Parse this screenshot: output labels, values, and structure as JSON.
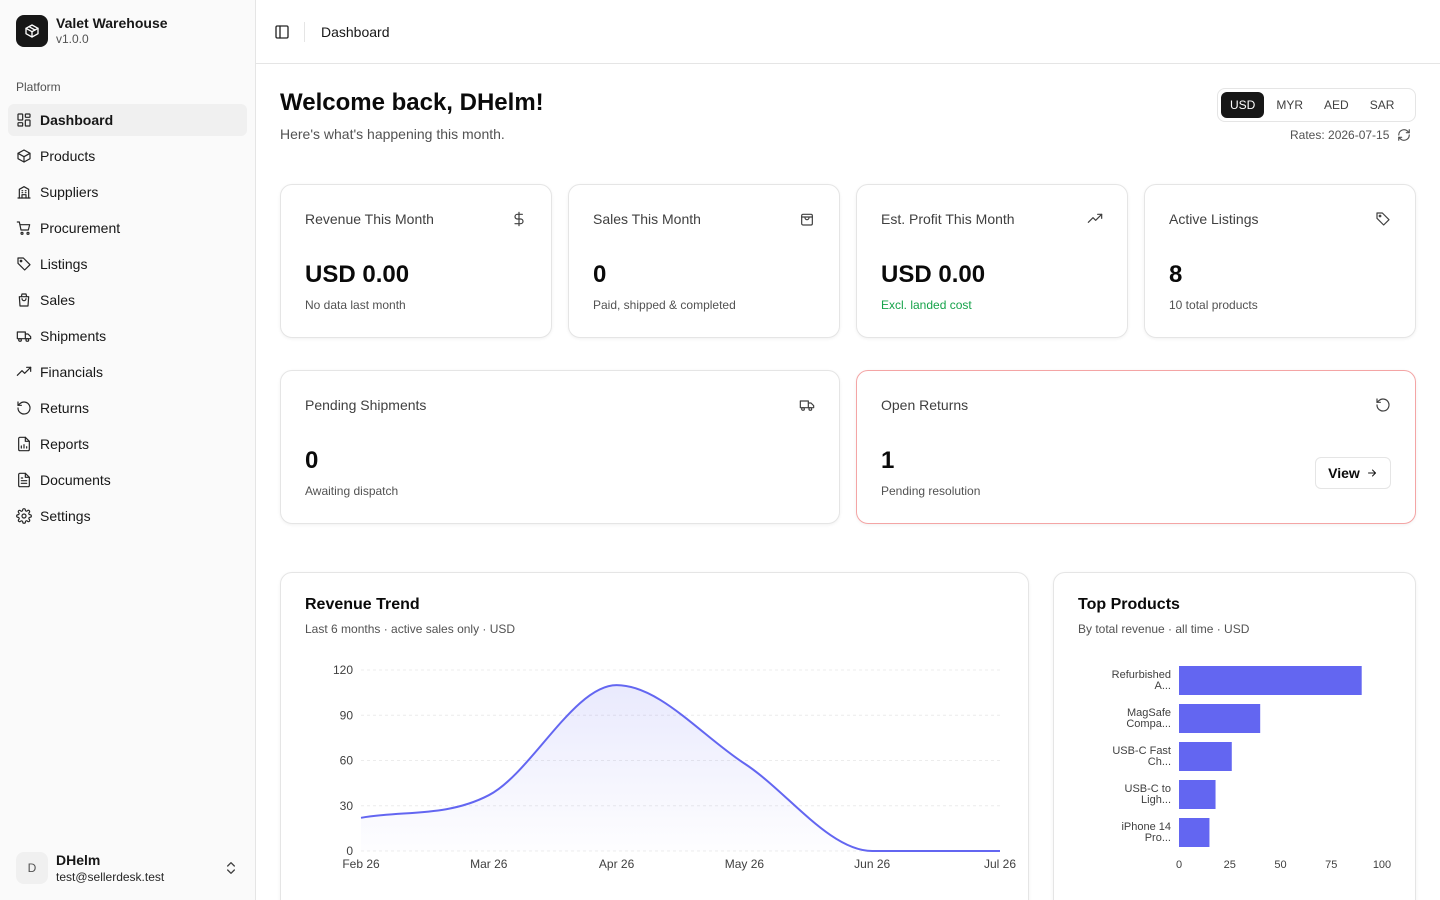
{
  "sidebar": {
    "brand_name": "Valet Warehouse",
    "brand_version": "v1.0.0",
    "group_label": "Platform",
    "items": [
      {
        "label": "Dashboard",
        "icon": "layout-dashboard-icon",
        "active": true
      },
      {
        "label": "Products",
        "icon": "package-icon"
      },
      {
        "label": "Suppliers",
        "icon": "building-icon"
      },
      {
        "label": "Procurement",
        "icon": "shopping-cart-icon"
      },
      {
        "label": "Listings",
        "icon": "tag-icon"
      },
      {
        "label": "Sales",
        "icon": "shopping-bag-icon"
      },
      {
        "label": "Shipments",
        "icon": "truck-icon"
      },
      {
        "label": "Financials",
        "icon": "trending-up-icon"
      },
      {
        "label": "Returns",
        "icon": "rotate-ccw-icon"
      },
      {
        "label": "Reports",
        "icon": "file-chart-icon"
      },
      {
        "label": "Documents",
        "icon": "file-text-icon"
      },
      {
        "label": "Settings",
        "icon": "settings-icon"
      }
    ],
    "user": {
      "initial": "D",
      "name": "DHelm",
      "email": "test@sellerdesk.test"
    }
  },
  "header": {
    "breadcrumb": "Dashboard"
  },
  "main": {
    "welcome": "Welcome back, DHelm!",
    "subtitle": "Here's what's happening this month.",
    "currencies": [
      "USD",
      "MYR",
      "AED",
      "SAR"
    ],
    "selected_currency": "USD",
    "rates": "Rates: 2026-07-15",
    "stats": [
      {
        "title": "Revenue This Month",
        "value": "USD 0.00",
        "sub": "No data last month",
        "icon": "dollar-icon"
      },
      {
        "title": "Sales This Month",
        "value": "0",
        "sub": "Paid, shipped & completed",
        "icon": "shopping-bag-icon"
      },
      {
        "title": "Est. Profit This Month",
        "value": "USD 0.00",
        "sub": "Excl. landed cost",
        "icon": "trending-up-icon"
      },
      {
        "title": "Active Listings",
        "value": "8",
        "sub": "10 total products",
        "icon": "tag-icon"
      }
    ],
    "pending_shipments": {
      "title": "Pending Shipments",
      "value": "0",
      "sub": "Awaiting dispatch",
      "icon": "truck-icon"
    },
    "open_returns": {
      "title": "Open Returns",
      "value": "1",
      "sub": "Pending resolution",
      "icon": "rotate-ccw-icon",
      "button": "View"
    },
    "revenue_trend": {
      "title": "Revenue Trend",
      "subtitle": "Last 6 months · active sales only · USD"
    },
    "top_products": {
      "title": "Top Products",
      "subtitle": "By total revenue · all time · USD"
    }
  },
  "colors": {
    "accent": "#6366f1",
    "alert_border": "#f4a5a5",
    "positive": "#16a34a"
  },
  "chart_data": [
    {
      "type": "area",
      "title": "Revenue Trend",
      "x": [
        "Feb 26",
        "Mar 26",
        "Apr 26",
        "May 26",
        "Jun 26",
        "Jul 26"
      ],
      "values": [
        22,
        37,
        110,
        58,
        0,
        0
      ],
      "yticks": [
        0,
        30,
        60,
        90,
        120
      ],
      "ylim": [
        0,
        120
      ],
      "grid": true
    },
    {
      "type": "bar",
      "orientation": "horizontal",
      "title": "Top Products",
      "categories": [
        [
          "Refurbished",
          "A..."
        ],
        [
          "MagSafe",
          "Compa..."
        ],
        [
          "USB-C Fast",
          "Ch..."
        ],
        [
          "USB-C to",
          "Ligh..."
        ],
        [
          "iPhone 14",
          "Pro..."
        ]
      ],
      "values": [
        90,
        40,
        26,
        18,
        15
      ],
      "xticks": [
        0,
        25,
        50,
        75,
        100
      ],
      "xlim": [
        0,
        100
      ]
    }
  ]
}
